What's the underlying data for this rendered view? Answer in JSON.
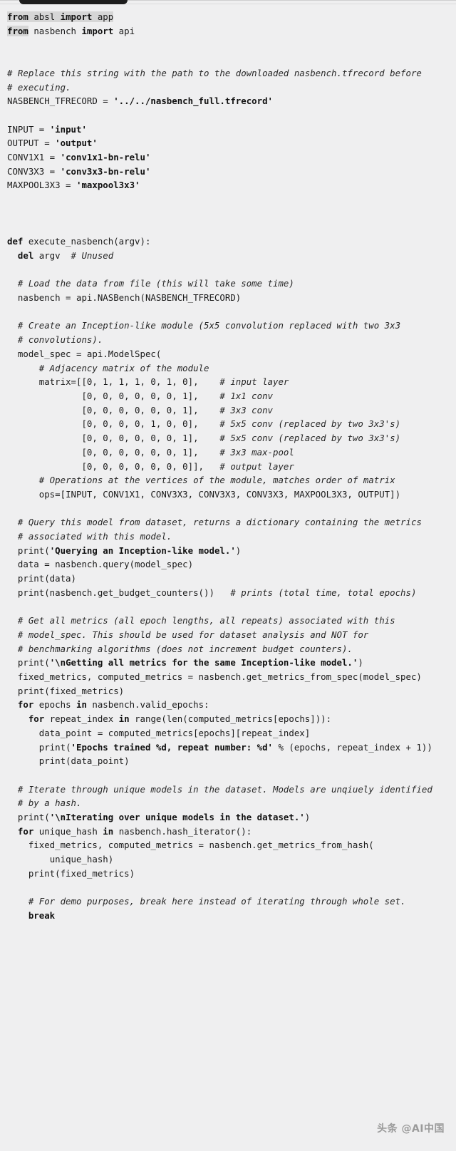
{
  "panel": {
    "language": "python",
    "background_color": "#efeff0",
    "text_color": "#1a1a1a",
    "selection_color": "#d6d6d6"
  },
  "popup": {
    "name": "selection-popup-anchor",
    "color": "#1d1d1d"
  },
  "watermark": {
    "text": "头条 @AI中国",
    "color": "#9a9a9a"
  },
  "code": {
    "lines": [
      {
        "id": "l1",
        "selected": true,
        "segments": [
          {
            "t": "from ",
            "k": "kw"
          },
          {
            "t": "absl ",
            "k": "plain"
          },
          {
            "t": "import ",
            "k": "kw"
          },
          {
            "t": "app",
            "k": "plain"
          }
        ]
      },
      {
        "id": "l2",
        "selected_prefix": 4,
        "segments": [
          {
            "t": "from ",
            "k": "kw"
          },
          {
            "t": "nasbench ",
            "k": "plain"
          },
          {
            "t": "import ",
            "k": "kw"
          },
          {
            "t": "api",
            "k": "plain"
          }
        ]
      },
      {
        "id": "l3",
        "segments": [
          {
            "t": "",
            "k": "plain"
          }
        ]
      },
      {
        "id": "l4",
        "segments": [
          {
            "t": "",
            "k": "plain"
          }
        ]
      },
      {
        "id": "l5",
        "segments": [
          {
            "t": "# Replace this string with the path to the downloaded nasbench.tfrecord before",
            "k": "cmt"
          }
        ]
      },
      {
        "id": "l6",
        "segments": [
          {
            "t": "# executing.",
            "k": "cmt"
          }
        ]
      },
      {
        "id": "l7",
        "segments": [
          {
            "t": "NASBENCH_TFRECORD = ",
            "k": "plain"
          },
          {
            "t": "'../../nasbench_full.tfrecord'",
            "k": "str"
          }
        ]
      },
      {
        "id": "l8",
        "segments": [
          {
            "t": "",
            "k": "plain"
          }
        ]
      },
      {
        "id": "l9",
        "segments": [
          {
            "t": "INPUT = ",
            "k": "plain"
          },
          {
            "t": "'input'",
            "k": "str"
          }
        ]
      },
      {
        "id": "l10",
        "segments": [
          {
            "t": "OUTPUT = ",
            "k": "plain"
          },
          {
            "t": "'output'",
            "k": "str"
          }
        ]
      },
      {
        "id": "l11",
        "segments": [
          {
            "t": "CONV1X1 = ",
            "k": "plain"
          },
          {
            "t": "'conv1x1-bn-relu'",
            "k": "str"
          }
        ]
      },
      {
        "id": "l12",
        "segments": [
          {
            "t": "CONV3X3 = ",
            "k": "plain"
          },
          {
            "t": "'conv3x3-bn-relu'",
            "k": "str"
          }
        ]
      },
      {
        "id": "l13",
        "segments": [
          {
            "t": "MAXPOOL3X3 = ",
            "k": "plain"
          },
          {
            "t": "'maxpool3x3'",
            "k": "str"
          }
        ]
      },
      {
        "id": "l14",
        "segments": [
          {
            "t": "",
            "k": "plain"
          }
        ]
      },
      {
        "id": "l15",
        "segments": [
          {
            "t": "",
            "k": "plain"
          }
        ]
      },
      {
        "id": "l16",
        "segments": [
          {
            "t": "",
            "k": "plain"
          }
        ]
      },
      {
        "id": "l17",
        "segments": [
          {
            "t": "def ",
            "k": "kw"
          },
          {
            "t": "execute_nasbench(argv):",
            "k": "plain"
          }
        ]
      },
      {
        "id": "l18",
        "segments": [
          {
            "t": "  ",
            "k": "plain"
          },
          {
            "t": "del ",
            "k": "kw"
          },
          {
            "t": "argv  ",
            "k": "plain"
          },
          {
            "t": "# Unused",
            "k": "cmt"
          }
        ]
      },
      {
        "id": "l19",
        "segments": [
          {
            "t": "",
            "k": "plain"
          }
        ]
      },
      {
        "id": "l20",
        "segments": [
          {
            "t": "  ",
            "k": "plain"
          },
          {
            "t": "# Load the data from file (this will take some time)",
            "k": "cmt"
          }
        ]
      },
      {
        "id": "l21",
        "segments": [
          {
            "t": "  nasbench = api.NASBench(NASBENCH_TFRECORD)",
            "k": "plain"
          }
        ]
      },
      {
        "id": "l22",
        "segments": [
          {
            "t": "",
            "k": "plain"
          }
        ]
      },
      {
        "id": "l23",
        "segments": [
          {
            "t": "  ",
            "k": "plain"
          },
          {
            "t": "# Create an Inception-like module (5x5 convolution replaced with two 3x3",
            "k": "cmt"
          }
        ]
      },
      {
        "id": "l24",
        "segments": [
          {
            "t": "  ",
            "k": "plain"
          },
          {
            "t": "# convolutions).",
            "k": "cmt"
          }
        ]
      },
      {
        "id": "l25",
        "segments": [
          {
            "t": "  model_spec = api.ModelSpec(",
            "k": "plain"
          }
        ]
      },
      {
        "id": "l26",
        "segments": [
          {
            "t": "      ",
            "k": "plain"
          },
          {
            "t": "# Adjacency matrix of the module",
            "k": "cmt"
          }
        ]
      },
      {
        "id": "l27",
        "segments": [
          {
            "t": "      matrix=[[0, 1, 1, 1, 0, 1, 0],    ",
            "k": "plain"
          },
          {
            "t": "# input layer",
            "k": "cmt"
          }
        ]
      },
      {
        "id": "l28",
        "segments": [
          {
            "t": "              [0, 0, 0, 0, 0, 0, 1],    ",
            "k": "plain"
          },
          {
            "t": "# 1x1 conv",
            "k": "cmt"
          }
        ]
      },
      {
        "id": "l29",
        "segments": [
          {
            "t": "              [0, 0, 0, 0, 0, 0, 1],    ",
            "k": "plain"
          },
          {
            "t": "# 3x3 conv",
            "k": "cmt"
          }
        ]
      },
      {
        "id": "l30",
        "segments": [
          {
            "t": "              [0, 0, 0, 0, 1, 0, 0],    ",
            "k": "plain"
          },
          {
            "t": "# 5x5 conv (replaced by two 3x3's)",
            "k": "cmt"
          }
        ]
      },
      {
        "id": "l31",
        "segments": [
          {
            "t": "              [0, 0, 0, 0, 0, 0, 1],    ",
            "k": "plain"
          },
          {
            "t": "# 5x5 conv (replaced by two 3x3's)",
            "k": "cmt"
          }
        ]
      },
      {
        "id": "l32",
        "segments": [
          {
            "t": "              [0, 0, 0, 0, 0, 0, 1],    ",
            "k": "plain"
          },
          {
            "t": "# 3x3 max-pool",
            "k": "cmt"
          }
        ]
      },
      {
        "id": "l33",
        "segments": [
          {
            "t": "              [0, 0, 0, 0, 0, 0, 0]],   ",
            "k": "plain"
          },
          {
            "t": "# output layer",
            "k": "cmt"
          }
        ]
      },
      {
        "id": "l34",
        "segments": [
          {
            "t": "      ",
            "k": "plain"
          },
          {
            "t": "# Operations at the vertices of the module, matches order of matrix",
            "k": "cmt"
          }
        ]
      },
      {
        "id": "l35",
        "segments": [
          {
            "t": "      ops=[INPUT, CONV1X1, CONV3X3, CONV3X3, CONV3X3, MAXPOOL3X3, OUTPUT])",
            "k": "plain"
          }
        ]
      },
      {
        "id": "l36",
        "segments": [
          {
            "t": "",
            "k": "plain"
          }
        ]
      },
      {
        "id": "l37",
        "segments": [
          {
            "t": "  ",
            "k": "plain"
          },
          {
            "t": "# Query this model from dataset, returns a dictionary containing the metrics",
            "k": "cmt"
          }
        ]
      },
      {
        "id": "l38",
        "segments": [
          {
            "t": "  ",
            "k": "plain"
          },
          {
            "t": "# associated with this model.",
            "k": "cmt"
          }
        ]
      },
      {
        "id": "l39",
        "segments": [
          {
            "t": "  print(",
            "k": "plain"
          },
          {
            "t": "'Querying an Inception-like model.'",
            "k": "str"
          },
          {
            "t": ")",
            "k": "plain"
          }
        ]
      },
      {
        "id": "l40",
        "segments": [
          {
            "t": "  data = nasbench.query(model_spec)",
            "k": "plain"
          }
        ]
      },
      {
        "id": "l41",
        "segments": [
          {
            "t": "  print(data)",
            "k": "plain"
          }
        ]
      },
      {
        "id": "l42",
        "segments": [
          {
            "t": "  print(nasbench.get_budget_counters())   ",
            "k": "plain"
          },
          {
            "t": "# prints (total time, total epochs)",
            "k": "cmt"
          }
        ]
      },
      {
        "id": "l43",
        "segments": [
          {
            "t": "",
            "k": "plain"
          }
        ]
      },
      {
        "id": "l44",
        "segments": [
          {
            "t": "  ",
            "k": "plain"
          },
          {
            "t": "# Get all metrics (all epoch lengths, all repeats) associated with this",
            "k": "cmt"
          }
        ]
      },
      {
        "id": "l45",
        "segments": [
          {
            "t": "  ",
            "k": "plain"
          },
          {
            "t": "# model_spec. This should be used for dataset analysis and NOT for",
            "k": "cmt"
          }
        ]
      },
      {
        "id": "l46",
        "segments": [
          {
            "t": "  ",
            "k": "plain"
          },
          {
            "t": "# benchmarking algorithms (does not increment budget counters).",
            "k": "cmt"
          }
        ]
      },
      {
        "id": "l47",
        "segments": [
          {
            "t": "  print(",
            "k": "plain"
          },
          {
            "t": "'\\nGetting all metrics for the same Inception-like model.'",
            "k": "str"
          },
          {
            "t": ")",
            "k": "plain"
          }
        ]
      },
      {
        "id": "l48",
        "segments": [
          {
            "t": "  fixed_metrics, computed_metrics = nasbench.get_metrics_from_spec(model_spec)",
            "k": "plain"
          }
        ]
      },
      {
        "id": "l49",
        "segments": [
          {
            "t": "  print(fixed_metrics)",
            "k": "plain"
          }
        ]
      },
      {
        "id": "l50",
        "segments": [
          {
            "t": "  ",
            "k": "plain"
          },
          {
            "t": "for ",
            "k": "kw"
          },
          {
            "t": "epochs ",
            "k": "plain"
          },
          {
            "t": "in ",
            "k": "kw"
          },
          {
            "t": "nasbench.valid_epochs:",
            "k": "plain"
          }
        ]
      },
      {
        "id": "l51",
        "segments": [
          {
            "t": "    ",
            "k": "plain"
          },
          {
            "t": "for ",
            "k": "kw"
          },
          {
            "t": "repeat_index ",
            "k": "plain"
          },
          {
            "t": "in ",
            "k": "kw"
          },
          {
            "t": "range(len(computed_metrics[epochs])):",
            "k": "plain"
          }
        ]
      },
      {
        "id": "l52",
        "segments": [
          {
            "t": "      data_point = computed_metrics[epochs][repeat_index]",
            "k": "plain"
          }
        ]
      },
      {
        "id": "l53",
        "segments": [
          {
            "t": "      print(",
            "k": "plain"
          },
          {
            "t": "'Epochs trained %d, repeat number: %d'",
            "k": "str"
          },
          {
            "t": " % (epochs, repeat_index + 1))",
            "k": "plain"
          }
        ]
      },
      {
        "id": "l54",
        "segments": [
          {
            "t": "      print(data_point)",
            "k": "plain"
          }
        ]
      },
      {
        "id": "l55",
        "segments": [
          {
            "t": "",
            "k": "plain"
          }
        ]
      },
      {
        "id": "l56",
        "segments": [
          {
            "t": "  ",
            "k": "plain"
          },
          {
            "t": "# Iterate through unique models in the dataset. Models are unqiuely identified",
            "k": "cmt"
          }
        ]
      },
      {
        "id": "l57",
        "segments": [
          {
            "t": "  ",
            "k": "plain"
          },
          {
            "t": "# by a hash.",
            "k": "cmt"
          }
        ]
      },
      {
        "id": "l58",
        "segments": [
          {
            "t": "  print(",
            "k": "plain"
          },
          {
            "t": "'\\nIterating over unique models in the dataset.'",
            "k": "str"
          },
          {
            "t": ")",
            "k": "plain"
          }
        ]
      },
      {
        "id": "l59",
        "segments": [
          {
            "t": "  ",
            "k": "plain"
          },
          {
            "t": "for ",
            "k": "kw"
          },
          {
            "t": "unique_hash ",
            "k": "plain"
          },
          {
            "t": "in ",
            "k": "kw"
          },
          {
            "t": "nasbench.hash_iterator():",
            "k": "plain"
          }
        ]
      },
      {
        "id": "l60",
        "segments": [
          {
            "t": "    fixed_metrics, computed_metrics = nasbench.get_metrics_from_hash(",
            "k": "plain"
          }
        ]
      },
      {
        "id": "l61",
        "segments": [
          {
            "t": "        unique_hash)",
            "k": "plain"
          }
        ]
      },
      {
        "id": "l62",
        "segments": [
          {
            "t": "    print(fixed_metrics)",
            "k": "plain"
          }
        ]
      },
      {
        "id": "l63",
        "segments": [
          {
            "t": "",
            "k": "plain"
          }
        ]
      },
      {
        "id": "l64",
        "segments": [
          {
            "t": "    ",
            "k": "plain"
          },
          {
            "t": "# For demo purposes, break here instead of iterating through whole set.",
            "k": "cmt"
          }
        ]
      },
      {
        "id": "l65",
        "segments": [
          {
            "t": "    ",
            "k": "plain"
          },
          {
            "t": "break",
            "k": "kw"
          }
        ]
      }
    ]
  }
}
